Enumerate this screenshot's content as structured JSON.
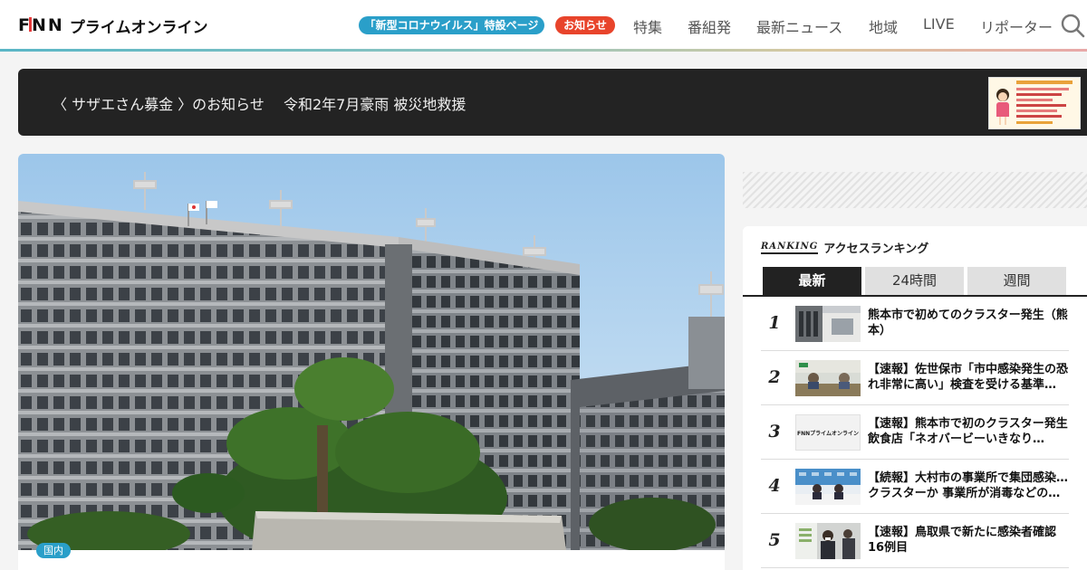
{
  "header": {
    "logo_fnn": "FNN",
    "logo_text": "プライムオンライン",
    "corona_pill": "「新型コロナウイルス」特設ページ",
    "news_pill": "お知らせ",
    "nav": [
      "特集",
      "番組発",
      "最新ニュース",
      "地域",
      "LIVE",
      "リポーター"
    ]
  },
  "banner": {
    "text": "〈 サザエさん募金 〉のお知らせ　 令和2年7月豪雨 被災地救援"
  },
  "article": {
    "category": "国内"
  },
  "ranking": {
    "logo": "RANKING",
    "title": "アクセスランキング",
    "tabs": [
      "最新",
      "24時間",
      "週間"
    ],
    "active_tab": "最新",
    "items": [
      {
        "rank": "1",
        "title": "熊本市で初めてのクラスター発生（熊本）"
      },
      {
        "rank": "2",
        "title": "【速報】佐世保市「市中感染発生の恐れ非常に高い」検査を受ける基準…"
      },
      {
        "rank": "3",
        "title": "【速報】熊本市で初のクラスター発生　飲食店「ネオバービーいきなり…"
      },
      {
        "rank": "4",
        "title": "【続報】大村市の事業所で集団感染…クラスターか 事業所が消毒などの…"
      },
      {
        "rank": "5",
        "title": "【速報】鳥取県で新たに感染者確認 16例目"
      }
    ],
    "thumb3_logo": "FNNプライムオンライン"
  },
  "colors": {
    "accent_blue": "#2a9fc9",
    "accent_red": "#e8442b",
    "banner_bg": "#232323"
  }
}
